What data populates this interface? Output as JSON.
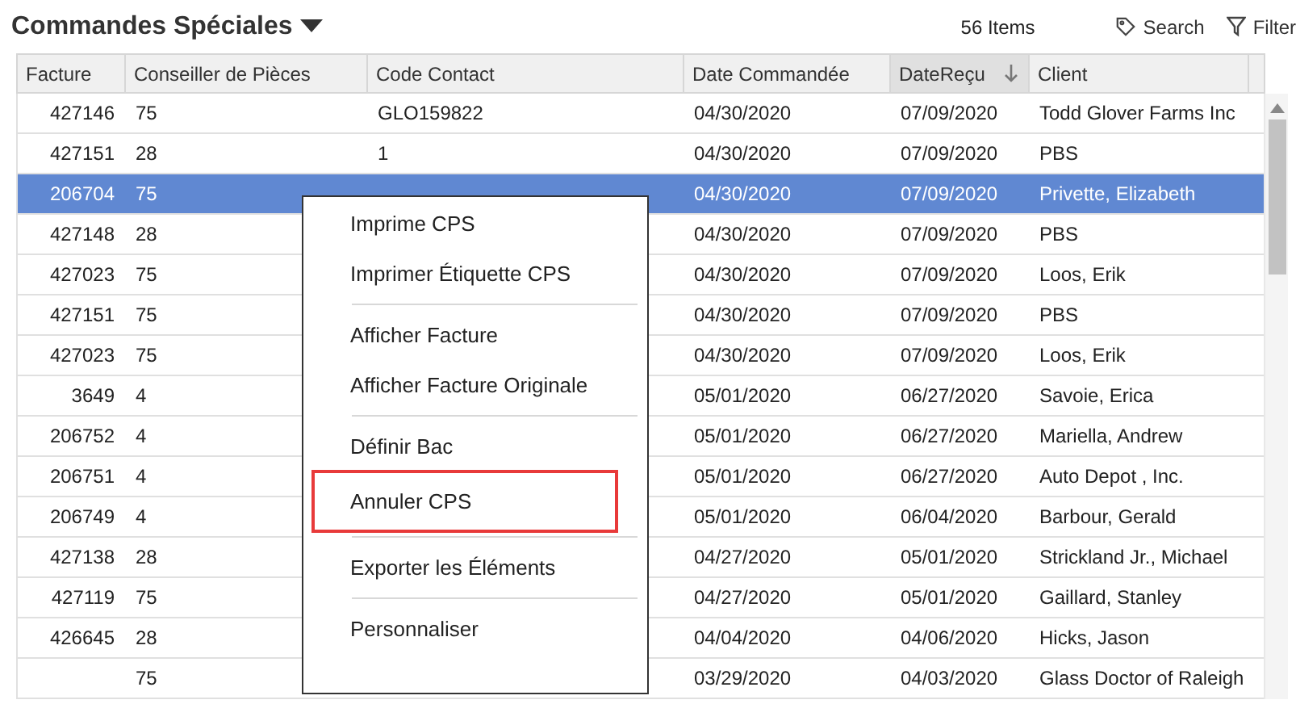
{
  "header": {
    "title": "Commandes Spéciales",
    "count": "56 Items",
    "actions": [
      {
        "kind": "search",
        "label": "Search"
      },
      {
        "kind": "filter",
        "label": "Filter"
      }
    ]
  },
  "table": {
    "columns": [
      {
        "label": "Facture",
        "sorted": false
      },
      {
        "label": "Conseiller de Pièces",
        "sorted": false
      },
      {
        "label": "Code Contact",
        "sorted": false
      },
      {
        "label": "Date Commandée",
        "sorted": false
      },
      {
        "label": "DateReçu",
        "sorted": true
      },
      {
        "label": "Client",
        "sorted": false
      }
    ],
    "rows": [
      {
        "selected": false,
        "facture": "427146",
        "conseiller": "75",
        "code_contact": "GLO159822",
        "date_commandee": "04/30/2020",
        "date_recu": "07/09/2020",
        "client": "Todd Glover Farms Inc"
      },
      {
        "selected": false,
        "facture": "427151",
        "conseiller": "28",
        "code_contact": "1",
        "date_commandee": "04/30/2020",
        "date_recu": "07/09/2020",
        "client": "PBS"
      },
      {
        "selected": true,
        "facture": "206704",
        "conseiller": "75",
        "date_commandee": "04/30/2020",
        "date_recu": "07/09/2020",
        "client": "Privette, Elizabeth"
      },
      {
        "selected": false,
        "facture": "427148",
        "conseiller": "28",
        "date_commandee": "04/30/2020",
        "date_recu": "07/09/2020",
        "client": "PBS"
      },
      {
        "selected": false,
        "facture": "427023",
        "conseiller": "75",
        "date_commandee": "04/30/2020",
        "date_recu": "07/09/2020",
        "client": "Loos, Erik"
      },
      {
        "selected": false,
        "facture": "427151",
        "conseiller": "75",
        "date_commandee": "04/30/2020",
        "date_recu": "07/09/2020",
        "client": "PBS"
      },
      {
        "selected": false,
        "facture": "427023",
        "conseiller": "75",
        "date_commandee": "04/30/2020",
        "date_recu": "07/09/2020",
        "client": "Loos, Erik"
      },
      {
        "selected": false,
        "facture": "3649",
        "conseiller": "4",
        "date_commandee": "05/01/2020",
        "date_recu": "06/27/2020",
        "client": "Savoie, Erica"
      },
      {
        "selected": false,
        "facture": "206752",
        "conseiller": "4",
        "date_commandee": "05/01/2020",
        "date_recu": "06/27/2020",
        "client": "Mariella, Andrew"
      },
      {
        "selected": false,
        "facture": "206751",
        "conseiller": "4",
        "date_commandee": "05/01/2020",
        "date_recu": "06/27/2020",
        "client": "Auto Depot ,  Inc."
      },
      {
        "selected": false,
        "facture": "206749",
        "conseiller": "4",
        "date_commandee": "05/01/2020",
        "date_recu": "06/04/2020",
        "client": "Barbour, Gerald"
      },
      {
        "selected": false,
        "facture": "427138",
        "conseiller": "28",
        "date_commandee": "04/27/2020",
        "date_recu": "05/01/2020",
        "client": "Strickland Jr., Michael"
      },
      {
        "selected": false,
        "facture": "427119",
        "conseiller": "75",
        "date_commandee": "04/27/2020",
        "date_recu": "05/01/2020",
        "client": "Gaillard, Stanley"
      },
      {
        "selected": false,
        "facture": "426645",
        "conseiller": "28",
        "date_commandee": "04/04/2020",
        "date_recu": "04/06/2020",
        "client": "Hicks, Jason"
      },
      {
        "selected": false,
        "conseiller": "75",
        "date_commandee": "03/29/2020",
        "date_recu": "04/03/2020",
        "client": "Glass Doctor of Raleigh"
      }
    ]
  },
  "context_menu": {
    "groups": [
      [
        {
          "label": "Imprime CPS",
          "highlighted": false
        },
        {
          "label": "Imprimer Étiquette CPS",
          "highlighted": false
        }
      ],
      [
        {
          "label": "Afficher Facture",
          "highlighted": false
        },
        {
          "label": "Afficher Facture Originale",
          "highlighted": false
        }
      ],
      [
        {
          "label": "Définir Bac",
          "highlighted": false
        },
        {
          "label": "Annuler CPS",
          "highlighted": true
        }
      ],
      [
        {
          "label": "Exporter les Éléments",
          "highlighted": false
        }
      ],
      [
        {
          "label": "Personnaliser",
          "highlighted": false
        }
      ]
    ]
  }
}
